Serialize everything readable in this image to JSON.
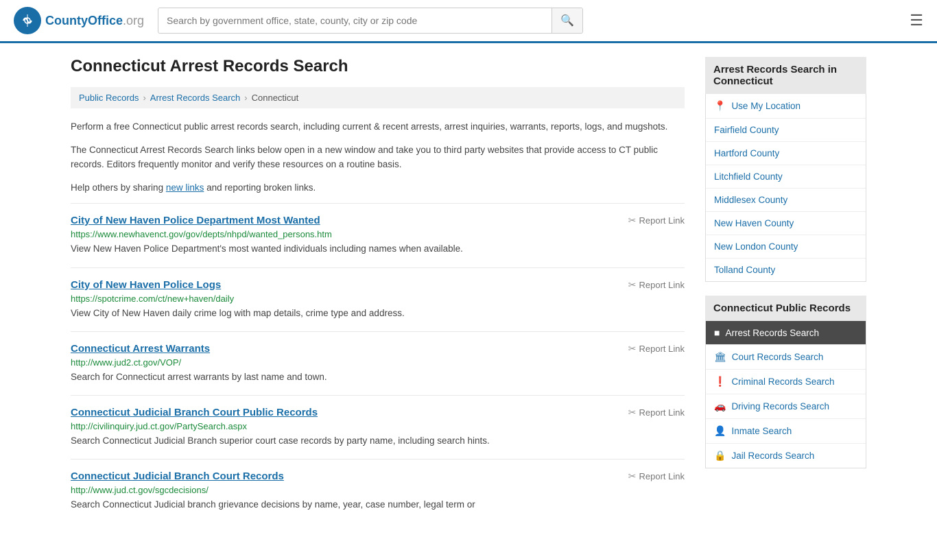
{
  "header": {
    "logo_text": "CountyOffice",
    "logo_suffix": ".org",
    "search_placeholder": "Search by government office, state, county, city or zip code"
  },
  "page": {
    "title": "Connecticut Arrest Records Search",
    "breadcrumb": [
      {
        "label": "Public Records",
        "href": "#"
      },
      {
        "label": "Arrest Records Search",
        "href": "#"
      },
      {
        "label": "Connecticut",
        "href": "#"
      }
    ],
    "description1": "Perform a free Connecticut public arrest records search, including current & recent arrests, arrest inquiries, warrants, reports, logs, and mugshots.",
    "description2": "The Connecticut Arrest Records Search links below open in a new window and take you to third party websites that provide access to CT public records. Editors frequently monitor and verify these resources on a routine basis.",
    "description3_prefix": "Help others by sharing ",
    "description3_link": "new links",
    "description3_suffix": " and reporting broken links.",
    "results": [
      {
        "title": "City of New Haven Police Department Most Wanted",
        "url": "https://www.newhavenct.gov/gov/depts/nhpd/wanted_persons.htm",
        "desc": "View New Haven Police Department's most wanted individuals including names when available.",
        "report_label": "Report Link"
      },
      {
        "title": "City of New Haven Police Logs",
        "url": "https://spotcrime.com/ct/new+haven/daily",
        "desc": "View City of New Haven daily crime log with map details, crime type and address.",
        "report_label": "Report Link"
      },
      {
        "title": "Connecticut Arrest Warrants",
        "url": "http://www.jud2.ct.gov/VOP/",
        "desc": "Search for Connecticut arrest warrants by last name and town.",
        "report_label": "Report Link"
      },
      {
        "title": "Connecticut Judicial Branch Court Public Records",
        "url": "http://civilinquiry.jud.ct.gov/PartySearch.aspx",
        "desc": "Search Connecticut Judicial Branch superior court case records by party name, including search hints.",
        "report_label": "Report Link"
      },
      {
        "title": "Connecticut Judicial Branch Court Records",
        "url": "http://www.jud.ct.gov/sgcdecisions/",
        "desc": "Search Connecticut Judicial branch grievance decisions by name, year, case number, legal term or",
        "report_label": "Report Link"
      }
    ]
  },
  "sidebar": {
    "section1_title": "Arrest Records Search in Connecticut",
    "location_label": "Use My Location",
    "counties": [
      "Fairfield County",
      "Hartford County",
      "Litchfield County",
      "Middlesex County",
      "New Haven County",
      "New London County",
      "Tolland County"
    ],
    "section2_title": "Connecticut Public Records",
    "public_records_links": [
      {
        "label": "Arrest Records Search",
        "icon": "square",
        "active": true
      },
      {
        "label": "Court Records Search",
        "icon": "bank"
      },
      {
        "label": "Criminal Records Search",
        "icon": "exclamation"
      },
      {
        "label": "Driving Records Search",
        "icon": "car"
      },
      {
        "label": "Inmate Search",
        "icon": "person"
      },
      {
        "label": "Jail Records Search",
        "icon": "lock"
      }
    ]
  }
}
